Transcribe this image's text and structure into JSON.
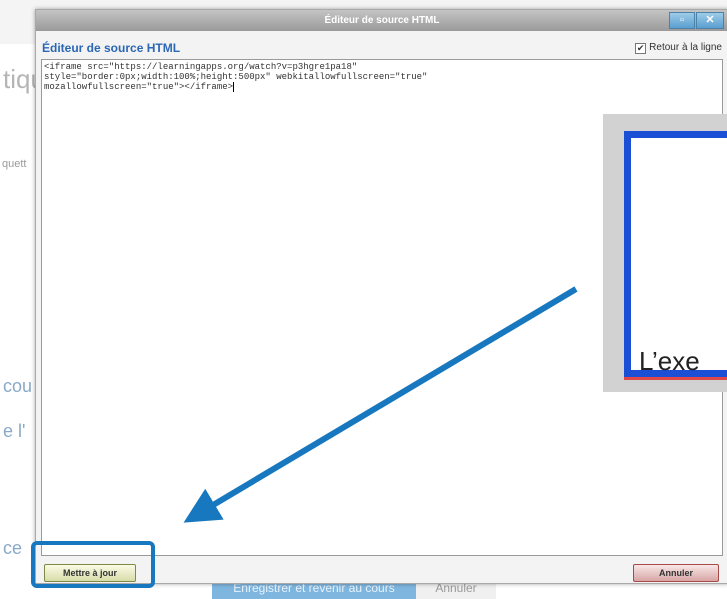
{
  "background": {
    "big_fragment": "tiqu",
    "small_fragment": "quett",
    "link1": "cou",
    "link2": "e l'",
    "link3": "ce",
    "footer_primary": "Enregistrer et revenir au cours",
    "footer_secondary": "Annuler"
  },
  "dialog": {
    "title": "Éditeur de source HTML",
    "heading": "Éditeur de source HTML",
    "wrap_label": "Retour à la ligne",
    "wrap_checked": true,
    "window_buttons": [
      "minimize-icon",
      "close-icon"
    ],
    "code_lines": [
      "<iframe src=\"https://learningapps.org/watch?v=p3hgre1pa18\"",
      "style=\"border:0px;width:100%;height:500px\" webkitallowfullscreen=\"true\"",
      "mozallowfullscreen=\"true\"></iframe>"
    ],
    "update_button": "Mettre à jour",
    "cancel_button": "Annuler"
  },
  "overlay": {
    "preview_text": "L’exe",
    "accent_color": "#1777bf",
    "preview_border_color": "#1a4fd6"
  }
}
